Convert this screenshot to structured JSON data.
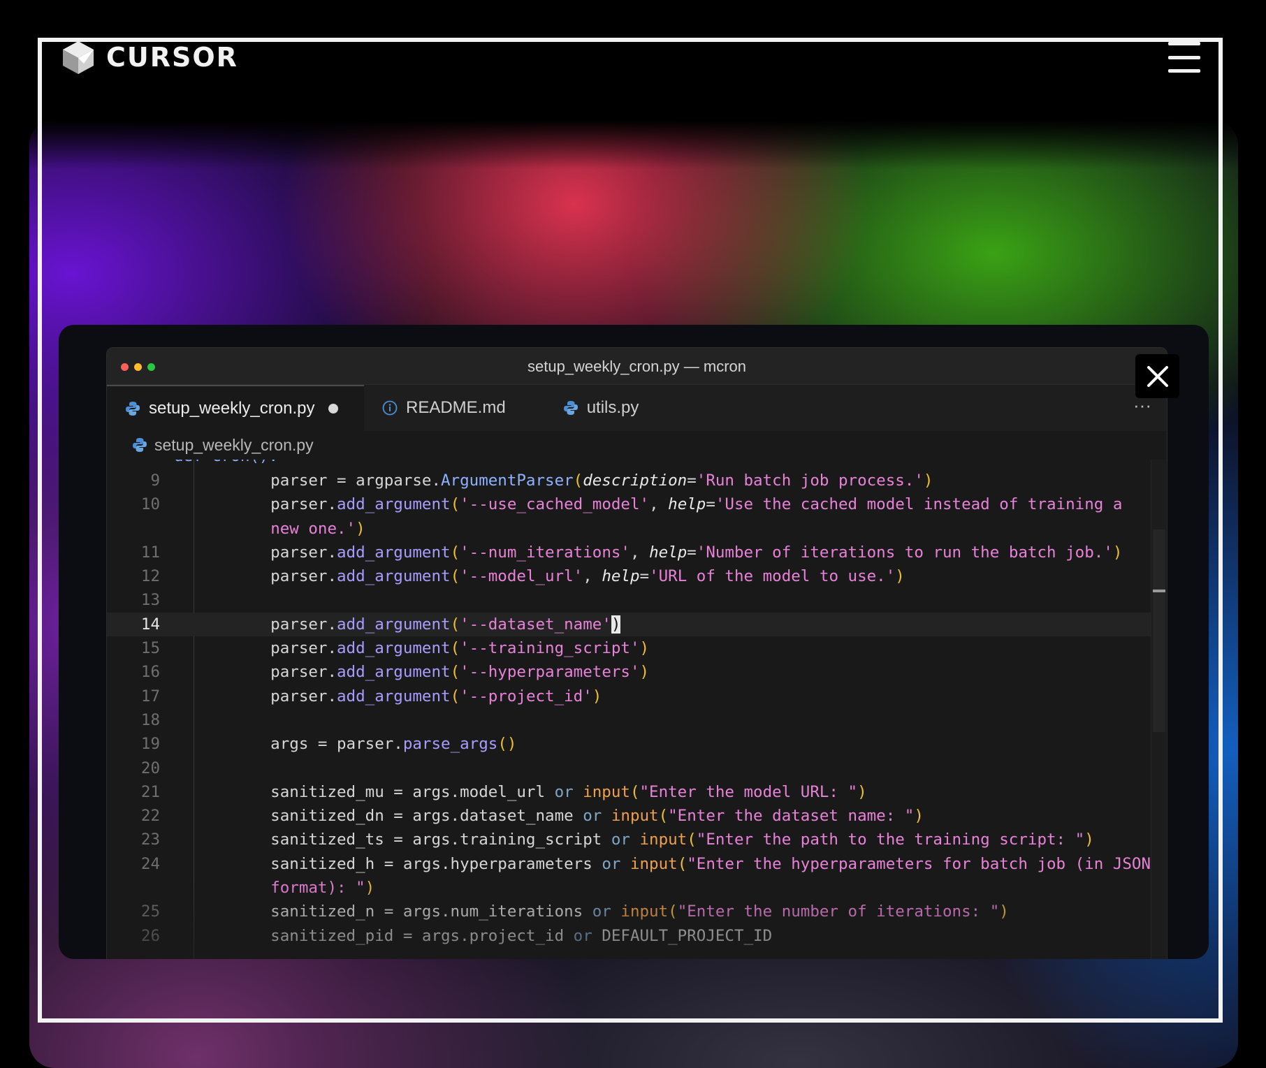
{
  "brand": {
    "name": "CURSOR"
  },
  "window": {
    "title": "setup_weekly_cron.py — mcron",
    "traffic_colors": [
      "#fe5f57",
      "#febc2e",
      "#28c840"
    ]
  },
  "tabs": [
    {
      "label": "setup_weekly_cron.py",
      "icon": "python-icon",
      "active": true,
      "modified": true
    },
    {
      "label": "README.md",
      "icon": "info-icon",
      "active": false
    },
    {
      "label": "utils.py",
      "icon": "python-icon",
      "active": false
    }
  ],
  "breadcrumb": {
    "file": "setup_weekly_cron.py"
  },
  "editor": {
    "partial_top_text": "def cron():",
    "current_line": "14",
    "lines": [
      {
        "n": "9",
        "segs": [
          [
            "    parser = argparse.",
            ""
          ],
          [
            "ArgumentParser",
            "cls"
          ],
          [
            "(",
            "par"
          ],
          [
            "description",
            "it"
          ],
          [
            "=",
            ""
          ],
          [
            "'Run batch job process.'",
            "str"
          ],
          [
            ")",
            "par"
          ]
        ]
      },
      {
        "n": "10",
        "segs": [
          [
            "    parser.",
            ""
          ],
          [
            "add_argument",
            "fn"
          ],
          [
            "(",
            "par"
          ],
          [
            "'--use_cached_model'",
            "str"
          ],
          [
            ", ",
            ""
          ],
          [
            "help",
            "it"
          ],
          [
            "=",
            ""
          ],
          [
            "'Use the cached model instead of training a",
            "str"
          ]
        ]
      },
      {
        "n": "",
        "segs": [
          [
            "    ",
            ""
          ],
          [
            "new one.'",
            "str"
          ],
          [
            ")",
            "par"
          ]
        ]
      },
      {
        "n": "11",
        "segs": [
          [
            "    parser.",
            ""
          ],
          [
            "add_argument",
            "fn"
          ],
          [
            "(",
            "par"
          ],
          [
            "'--num_iterations'",
            "str"
          ],
          [
            ", ",
            ""
          ],
          [
            "help",
            "it"
          ],
          [
            "=",
            ""
          ],
          [
            "'Number of iterations to run the batch job.'",
            "str"
          ],
          [
            ")",
            "par"
          ]
        ]
      },
      {
        "n": "12",
        "segs": [
          [
            "    parser.",
            ""
          ],
          [
            "add_argument",
            "fn"
          ],
          [
            "(",
            "par"
          ],
          [
            "'--model_url'",
            "str"
          ],
          [
            ", ",
            ""
          ],
          [
            "help",
            "it"
          ],
          [
            "=",
            ""
          ],
          [
            "'URL of the model to use.'",
            "str"
          ],
          [
            ")",
            "par"
          ]
        ]
      },
      {
        "n": "13",
        "segs": []
      },
      {
        "n": "14",
        "segs": [
          [
            "    parser.",
            ""
          ],
          [
            "add_argument",
            "fn"
          ],
          [
            "(",
            "par"
          ],
          [
            "'--dataset_name'",
            "str"
          ],
          [
            ")",
            "cursor"
          ]
        ]
      },
      {
        "n": "15",
        "segs": [
          [
            "    parser.",
            ""
          ],
          [
            "add_argument",
            "fn"
          ],
          [
            "(",
            "par"
          ],
          [
            "'--training_script'",
            "str"
          ],
          [
            ")",
            "par"
          ]
        ]
      },
      {
        "n": "16",
        "segs": [
          [
            "    parser.",
            ""
          ],
          [
            "add_argument",
            "fn"
          ],
          [
            "(",
            "par"
          ],
          [
            "'--hyperparameters'",
            "str"
          ],
          [
            ")",
            "par"
          ]
        ]
      },
      {
        "n": "17",
        "segs": [
          [
            "    parser.",
            ""
          ],
          [
            "add_argument",
            "fn"
          ],
          [
            "(",
            "par"
          ],
          [
            "'--project_id'",
            "str"
          ],
          [
            ")",
            "par"
          ]
        ]
      },
      {
        "n": "18",
        "segs": []
      },
      {
        "n": "19",
        "segs": [
          [
            "    args = parser.",
            ""
          ],
          [
            "parse_args",
            "fn"
          ],
          [
            "()",
            "par"
          ]
        ]
      },
      {
        "n": "20",
        "segs": []
      },
      {
        "n": "21",
        "segs": [
          [
            "    sanitized_mu = args.model_url ",
            ""
          ],
          [
            "or",
            "or"
          ],
          [
            " ",
            ""
          ],
          [
            "input",
            "inp"
          ],
          [
            "(",
            "par"
          ],
          [
            "\"Enter the model URL: \"",
            "str"
          ],
          [
            ")",
            "par"
          ]
        ]
      },
      {
        "n": "22",
        "segs": [
          [
            "    sanitized_dn = args.dataset_name ",
            ""
          ],
          [
            "or",
            "or"
          ],
          [
            " ",
            ""
          ],
          [
            "input",
            "inp"
          ],
          [
            "(",
            "par"
          ],
          [
            "\"Enter the dataset name: \"",
            "str"
          ],
          [
            ")",
            "par"
          ]
        ]
      },
      {
        "n": "23",
        "segs": [
          [
            "    sanitized_ts = args.training_script ",
            ""
          ],
          [
            "or",
            "or"
          ],
          [
            " ",
            ""
          ],
          [
            "input",
            "inp"
          ],
          [
            "(",
            "par"
          ],
          [
            "\"Enter the path to the training script: \"",
            "str"
          ],
          [
            ")",
            "par"
          ]
        ]
      },
      {
        "n": "24",
        "segs": [
          [
            "    sanitized_h = args.hyperparameters ",
            ""
          ],
          [
            "or",
            "or"
          ],
          [
            " ",
            ""
          ],
          [
            "input",
            "inp"
          ],
          [
            "(",
            "par"
          ],
          [
            "\"Enter the hyperparameters for batch job (in JSON",
            "str"
          ]
        ]
      },
      {
        "n": "",
        "segs": [
          [
            "    ",
            ""
          ],
          [
            "format): \"",
            "str"
          ],
          [
            ")",
            "par"
          ]
        ]
      },
      {
        "n": "25",
        "segs": [
          [
            "    sanitized_n = args.num_iterations ",
            ""
          ],
          [
            "or",
            "or"
          ],
          [
            " ",
            ""
          ],
          [
            "input",
            "inp"
          ],
          [
            "(",
            "par"
          ],
          [
            "\"Enter the number of iterations: \"",
            "str"
          ],
          [
            ")",
            "par"
          ]
        ]
      },
      {
        "n": "26",
        "segs": [
          [
            "    sanitized_pid = args.project_id ",
            ""
          ],
          [
            "or",
            "or"
          ],
          [
            " DEFAULT_PROJECT_ID",
            ""
          ]
        ]
      }
    ]
  },
  "icons": {
    "logo": "cursor-logo-icon",
    "menu": "hamburger-menu-icon",
    "close": "close-icon",
    "more": "more-horizontal-icon"
  }
}
